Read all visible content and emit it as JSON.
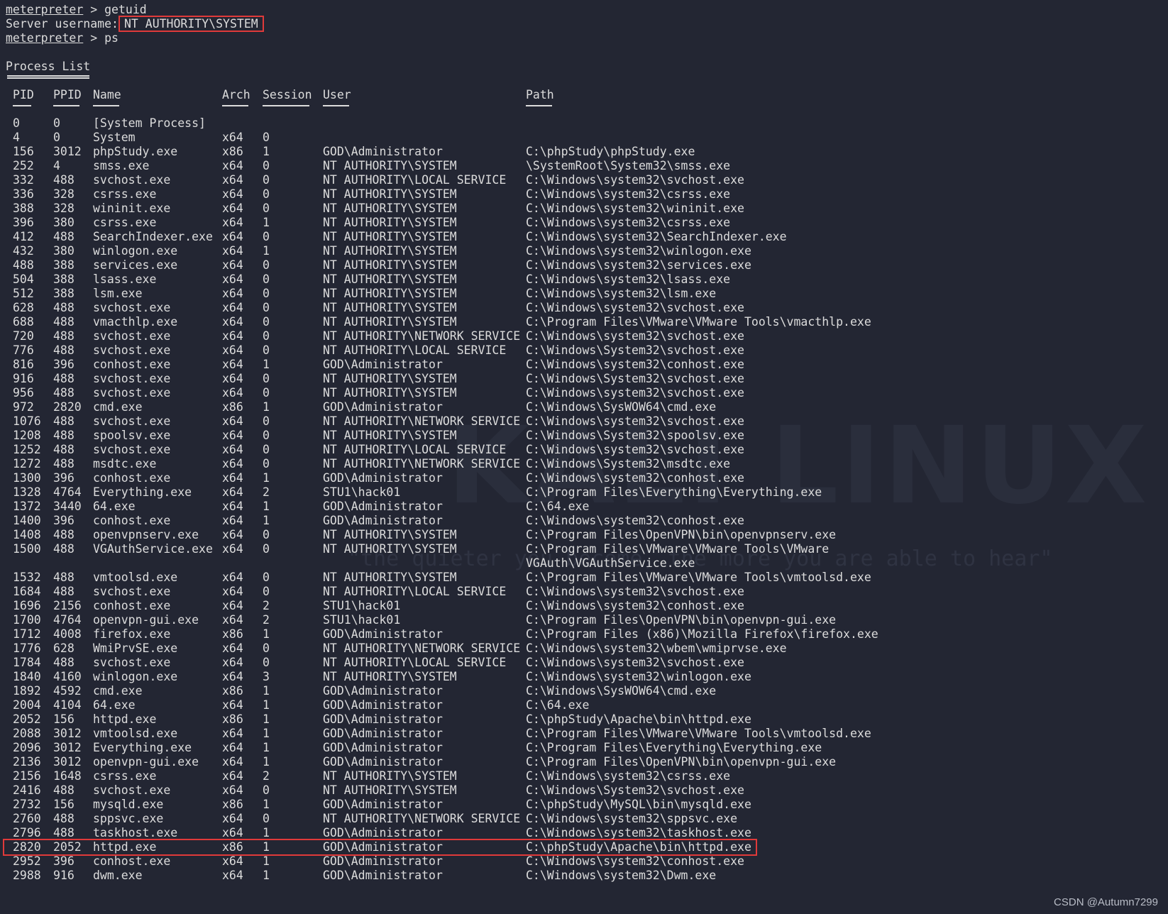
{
  "session": {
    "prompt": "meterpreter",
    "cmd1": " > getuid",
    "server_label": "Server username:",
    "server_user": "NT AUTHORITY\\SYSTEM",
    "cmd2": " > ps",
    "list_title": "Process List"
  },
  "headers": [
    "PID",
    "PPID",
    "Name",
    "Arch",
    "Session",
    "User",
    "Path"
  ],
  "rows": [
    [
      "0",
      "0",
      "[System Process]",
      "",
      "",
      "",
      ""
    ],
    [
      "4",
      "0",
      "System",
      "x64",
      "0",
      "",
      ""
    ],
    [
      "156",
      "3012",
      "phpStudy.exe",
      "x86",
      "1",
      "GOD\\Administrator",
      "C:\\phpStudy\\phpStudy.exe"
    ],
    [
      "252",
      "4",
      "smss.exe",
      "x64",
      "0",
      "NT AUTHORITY\\SYSTEM",
      "\\SystemRoot\\System32\\smss.exe"
    ],
    [
      "332",
      "488",
      "svchost.exe",
      "x64",
      "0",
      "NT AUTHORITY\\LOCAL SERVICE",
      "C:\\Windows\\system32\\svchost.exe"
    ],
    [
      "336",
      "328",
      "csrss.exe",
      "x64",
      "0",
      "NT AUTHORITY\\SYSTEM",
      "C:\\Windows\\system32\\csrss.exe"
    ],
    [
      "388",
      "328",
      "wininit.exe",
      "x64",
      "0",
      "NT AUTHORITY\\SYSTEM",
      "C:\\Windows\\system32\\wininit.exe"
    ],
    [
      "396",
      "380",
      "csrss.exe",
      "x64",
      "1",
      "NT AUTHORITY\\SYSTEM",
      "C:\\Windows\\system32\\csrss.exe"
    ],
    [
      "412",
      "488",
      "SearchIndexer.exe",
      "x64",
      "0",
      "NT AUTHORITY\\SYSTEM",
      "C:\\Windows\\system32\\SearchIndexer.exe"
    ],
    [
      "432",
      "380",
      "winlogon.exe",
      "x64",
      "1",
      "NT AUTHORITY\\SYSTEM",
      "C:\\Windows\\system32\\winlogon.exe"
    ],
    [
      "488",
      "388",
      "services.exe",
      "x64",
      "0",
      "NT AUTHORITY\\SYSTEM",
      "C:\\Windows\\system32\\services.exe"
    ],
    [
      "504",
      "388",
      "lsass.exe",
      "x64",
      "0",
      "NT AUTHORITY\\SYSTEM",
      "C:\\Windows\\system32\\lsass.exe"
    ],
    [
      "512",
      "388",
      "lsm.exe",
      "x64",
      "0",
      "NT AUTHORITY\\SYSTEM",
      "C:\\Windows\\system32\\lsm.exe"
    ],
    [
      "628",
      "488",
      "svchost.exe",
      "x64",
      "0",
      "NT AUTHORITY\\SYSTEM",
      "C:\\Windows\\system32\\svchost.exe"
    ],
    [
      "688",
      "488",
      "vmacthlp.exe",
      "x64",
      "0",
      "NT AUTHORITY\\SYSTEM",
      "C:\\Program Files\\VMware\\VMware Tools\\vmacthlp.exe"
    ],
    [
      "720",
      "488",
      "svchost.exe",
      "x64",
      "0",
      "NT AUTHORITY\\NETWORK SERVICE",
      "C:\\Windows\\system32\\svchost.exe"
    ],
    [
      "776",
      "488",
      "svchost.exe",
      "x64",
      "0",
      "NT AUTHORITY\\LOCAL SERVICE",
      "C:\\Windows\\System32\\svchost.exe"
    ],
    [
      "816",
      "396",
      "conhost.exe",
      "x64",
      "1",
      "GOD\\Administrator",
      "C:\\Windows\\system32\\conhost.exe"
    ],
    [
      "916",
      "488",
      "svchost.exe",
      "x64",
      "0",
      "NT AUTHORITY\\SYSTEM",
      "C:\\Windows\\System32\\svchost.exe"
    ],
    [
      "956",
      "488",
      "svchost.exe",
      "x64",
      "0",
      "NT AUTHORITY\\SYSTEM",
      "C:\\Windows\\system32\\svchost.exe"
    ],
    [
      "972",
      "2820",
      "cmd.exe",
      "x86",
      "1",
      "GOD\\Administrator",
      "C:\\Windows\\SysWOW64\\cmd.exe"
    ],
    [
      "1076",
      "488",
      "svchost.exe",
      "x64",
      "0",
      "NT AUTHORITY\\NETWORK SERVICE",
      "C:\\Windows\\system32\\svchost.exe"
    ],
    [
      "1208",
      "488",
      "spoolsv.exe",
      "x64",
      "0",
      "NT AUTHORITY\\SYSTEM",
      "C:\\Windows\\System32\\spoolsv.exe"
    ],
    [
      "1252",
      "488",
      "svchost.exe",
      "x64",
      "0",
      "NT AUTHORITY\\LOCAL SERVICE",
      "C:\\Windows\\system32\\svchost.exe"
    ],
    [
      "1272",
      "488",
      "msdtc.exe",
      "x64",
      "0",
      "NT AUTHORITY\\NETWORK SERVICE",
      "C:\\Windows\\System32\\msdtc.exe"
    ],
    [
      "1300",
      "396",
      "conhost.exe",
      "x64",
      "1",
      "GOD\\Administrator",
      "C:\\Windows\\system32\\conhost.exe"
    ],
    [
      "1328",
      "4764",
      "Everything.exe",
      "x64",
      "2",
      "STU1\\hack01",
      "C:\\Program Files\\Everything\\Everything.exe"
    ],
    [
      "1372",
      "3440",
      "64.exe",
      "x64",
      "1",
      "GOD\\Administrator",
      "C:\\64.exe"
    ],
    [
      "1400",
      "396",
      "conhost.exe",
      "x64",
      "1",
      "GOD\\Administrator",
      "C:\\Windows\\system32\\conhost.exe"
    ],
    [
      "1408",
      "488",
      "openvpnserv.exe",
      "x64",
      "0",
      "NT AUTHORITY\\SYSTEM",
      "C:\\Program Files\\OpenVPN\\bin\\openvpnserv.exe"
    ],
    [
      "1500",
      "488",
      "VGAuthService.exe",
      "x64",
      "0",
      "NT AUTHORITY\\SYSTEM",
      "C:\\Program Files\\VMware\\VMware Tools\\VMware VGAuth\\VGAuthService.exe"
    ],
    [
      "1532",
      "488",
      "vmtoolsd.exe",
      "x64",
      "0",
      "NT AUTHORITY\\SYSTEM",
      "C:\\Program Files\\VMware\\VMware Tools\\vmtoolsd.exe"
    ],
    [
      "1684",
      "488",
      "svchost.exe",
      "x64",
      "0",
      "NT AUTHORITY\\LOCAL SERVICE",
      "C:\\Windows\\system32\\svchost.exe"
    ],
    [
      "1696",
      "2156",
      "conhost.exe",
      "x64",
      "2",
      "STU1\\hack01",
      "C:\\Windows\\system32\\conhost.exe"
    ],
    [
      "1700",
      "4764",
      "openvpn-gui.exe",
      "x64",
      "2",
      "STU1\\hack01",
      "C:\\Program Files\\OpenVPN\\bin\\openvpn-gui.exe"
    ],
    [
      "1712",
      "4008",
      "firefox.exe",
      "x86",
      "1",
      "GOD\\Administrator",
      "C:\\Program Files (x86)\\Mozilla Firefox\\firefox.exe"
    ],
    [
      "1776",
      "628",
      "WmiPrvSE.exe",
      "x64",
      "0",
      "NT AUTHORITY\\NETWORK SERVICE",
      "C:\\Windows\\system32\\wbem\\wmiprvse.exe"
    ],
    [
      "1784",
      "488",
      "svchost.exe",
      "x64",
      "0",
      "NT AUTHORITY\\LOCAL SERVICE",
      "C:\\Windows\\system32\\svchost.exe"
    ],
    [
      "1840",
      "4160",
      "winlogon.exe",
      "x64",
      "3",
      "NT AUTHORITY\\SYSTEM",
      "C:\\Windows\\system32\\winlogon.exe"
    ],
    [
      "1892",
      "4592",
      "cmd.exe",
      "x86",
      "1",
      "GOD\\Administrator",
      "C:\\Windows\\SysWOW64\\cmd.exe"
    ],
    [
      "2004",
      "4104",
      "64.exe",
      "x64",
      "1",
      "GOD\\Administrator",
      "C:\\64.exe"
    ],
    [
      "2052",
      "156",
      "httpd.exe",
      "x86",
      "1",
      "GOD\\Administrator",
      "C:\\phpStudy\\Apache\\bin\\httpd.exe"
    ],
    [
      "2088",
      "3012",
      "vmtoolsd.exe",
      "x64",
      "1",
      "GOD\\Administrator",
      "C:\\Program Files\\VMware\\VMware Tools\\vmtoolsd.exe"
    ],
    [
      "2096",
      "3012",
      "Everything.exe",
      "x64",
      "1",
      "GOD\\Administrator",
      "C:\\Program Files\\Everything\\Everything.exe"
    ],
    [
      "2136",
      "3012",
      "openvpn-gui.exe",
      "x64",
      "1",
      "GOD\\Administrator",
      "C:\\Program Files\\OpenVPN\\bin\\openvpn-gui.exe"
    ],
    [
      "2156",
      "1648",
      "csrss.exe",
      "x64",
      "2",
      "NT AUTHORITY\\SYSTEM",
      "C:\\Windows\\system32\\csrss.exe"
    ],
    [
      "2416",
      "488",
      "svchost.exe",
      "x64",
      "0",
      "NT AUTHORITY\\SYSTEM",
      "C:\\Windows\\System32\\svchost.exe"
    ],
    [
      "2732",
      "156",
      "mysqld.exe",
      "x86",
      "1",
      "GOD\\Administrator",
      "C:\\phpStudy\\MySQL\\bin\\mysqld.exe"
    ],
    [
      "2760",
      "488",
      "sppsvc.exe",
      "x64",
      "0",
      "NT AUTHORITY\\NETWORK SERVICE",
      "C:\\Windows\\system32\\sppsvc.exe"
    ],
    [
      "2796",
      "488",
      "taskhost.exe",
      "x64",
      "1",
      "GOD\\Administrator",
      "C:\\Windows\\system32\\taskhost.exe"
    ],
    [
      "2820",
      "2052",
      "httpd.exe",
      "x86",
      "1",
      "GOD\\Administrator",
      "C:\\phpStudy\\Apache\\bin\\httpd.exe"
    ],
    [
      "2952",
      "396",
      "conhost.exe",
      "x64",
      "1",
      "GOD\\Administrator",
      "C:\\Windows\\system32\\conhost.exe"
    ],
    [
      "2988",
      "916",
      "dwm.exe",
      "x64",
      "1",
      "GOD\\Administrator",
      "C:\\Windows\\system32\\Dwm.exe"
    ]
  ],
  "highlight_pid": "2820",
  "background": {
    "watermark": "KALI LINUX",
    "tagline": "\"the quieter you become, the more you are able to hear\""
  },
  "footer": "CSDN @Autumn7299",
  "colors": {
    "bg": "#232633",
    "text": "#dcdcdc",
    "highlight": "#e03a3a"
  }
}
